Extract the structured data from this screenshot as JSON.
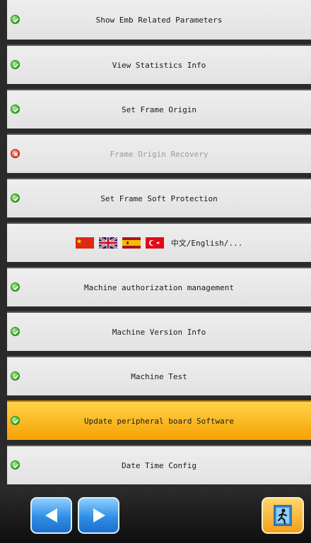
{
  "menu": {
    "items": [
      {
        "label": "Show Emb Related Parameters",
        "status": "ok"
      },
      {
        "label": "View Statistics Info",
        "status": "ok"
      },
      {
        "label": "Set Frame Origin",
        "status": "ok"
      },
      {
        "label": "Frame Origin Recovery",
        "status": "error"
      },
      {
        "label": "Set Frame Soft Protection",
        "status": "ok"
      },
      {
        "label": "中文/English/...",
        "status": "none"
      },
      {
        "label": "Machine authorization management",
        "status": "ok"
      },
      {
        "label": "Machine Version Info",
        "status": "ok"
      },
      {
        "label": "Machine Test",
        "status": "ok"
      },
      {
        "label": "Update peripheral board Software",
        "status": "ok",
        "selected": true
      },
      {
        "label": "Date Time Config",
        "status": "ok"
      }
    ],
    "language_flags": [
      "china-flag-icon",
      "uk-flag-icon",
      "spain-flag-icon",
      "turkey-flag-icon"
    ]
  },
  "colors": {
    "status_ok": "#3cab2a",
    "status_error": "#e2422f",
    "highlight": "#f5a200",
    "nav_blue": "#2f8ee6",
    "exit_orange": "#f3a01a"
  },
  "bottom_bar": {
    "buttons": [
      "prev-arrow-icon",
      "next-arrow-icon",
      "exit-door-icon"
    ]
  }
}
